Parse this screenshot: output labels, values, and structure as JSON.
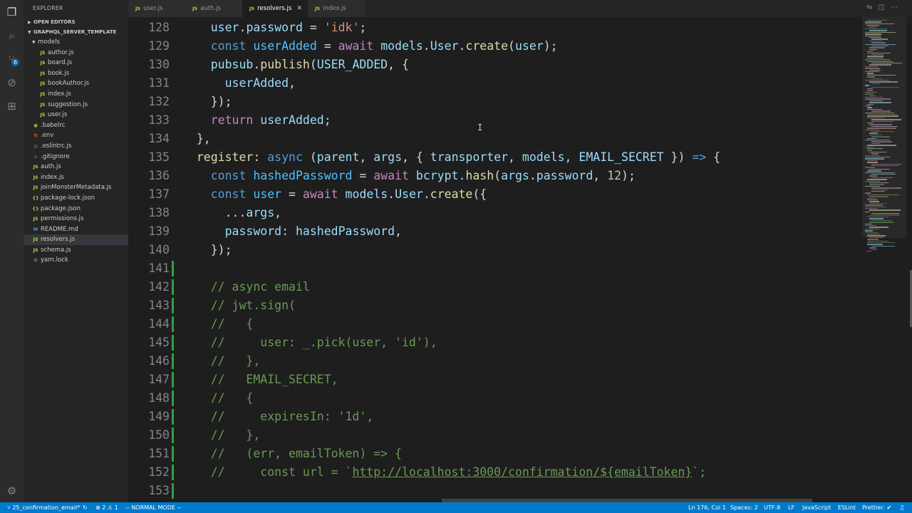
{
  "sidebar": {
    "title": "EXPLORER",
    "open_editors": "OPEN EDITORS",
    "project": "GRAPHQL_SERVER_TEMPLATE",
    "tree": [
      {
        "label": "models",
        "type": "folder",
        "depth": 1
      },
      {
        "label": "author.js",
        "type": "js",
        "depth": 2
      },
      {
        "label": "board.js",
        "type": "js",
        "depth": 2
      },
      {
        "label": "book.js",
        "type": "js",
        "depth": 2
      },
      {
        "label": "bookAuthor.js",
        "type": "js",
        "depth": 2
      },
      {
        "label": "index.js",
        "type": "js",
        "depth": 2
      },
      {
        "label": "suggestion.js",
        "type": "js",
        "depth": 2
      },
      {
        "label": "user.js",
        "type": "js",
        "depth": 2
      },
      {
        "label": ".babelrc",
        "type": "babel",
        "depth": 1
      },
      {
        "label": ".env",
        "type": "env",
        "depth": 1
      },
      {
        "label": ".eslintrc.js",
        "type": "eslint",
        "depth": 1
      },
      {
        "label": ".gitignore",
        "type": "git",
        "depth": 1
      },
      {
        "label": "auth.js",
        "type": "js",
        "depth": 1
      },
      {
        "label": "index.js",
        "type": "js",
        "depth": 1
      },
      {
        "label": "joinMonsterMetadata.js",
        "type": "js",
        "depth": 1
      },
      {
        "label": "package-lock.json",
        "type": "json",
        "depth": 1
      },
      {
        "label": "package.json",
        "type": "json",
        "depth": 1
      },
      {
        "label": "permissions.js",
        "type": "js",
        "depth": 1
      },
      {
        "label": "README.md",
        "type": "md",
        "depth": 1
      },
      {
        "label": "resolvers.js",
        "type": "js",
        "depth": 1,
        "selected": true
      },
      {
        "label": "schema.js",
        "type": "js",
        "depth": 1
      },
      {
        "label": "yarn.lock",
        "type": "yarn",
        "depth": 1
      }
    ]
  },
  "activity_badge": "6",
  "tabs": [
    {
      "label": "user.js",
      "active": false
    },
    {
      "label": "auth.js",
      "active": false
    },
    {
      "label": "resolvers.js",
      "active": true
    },
    {
      "label": "index.js",
      "active": false
    }
  ],
  "editor": {
    "lines": [
      {
        "n": "128",
        "mark": false,
        "tokens": [
          [
            "t",
            "    "
          ],
          [
            "v",
            "user"
          ],
          [
            "t",
            "."
          ],
          [
            "v",
            "password"
          ],
          [
            "t",
            " = "
          ],
          [
            "s",
            "'idk'"
          ],
          [
            "t",
            ";"
          ]
        ]
      },
      {
        "n": "129",
        "mark": false,
        "tokens": [
          [
            "t",
            "    "
          ],
          [
            "st",
            "const"
          ],
          [
            "t",
            " "
          ],
          [
            "cst",
            "userAdded"
          ],
          [
            "t",
            " = "
          ],
          [
            "k",
            "await"
          ],
          [
            "t",
            " "
          ],
          [
            "v",
            "models"
          ],
          [
            "t",
            "."
          ],
          [
            "v",
            "User"
          ],
          [
            "t",
            "."
          ],
          [
            "f",
            "create"
          ],
          [
            "t",
            "("
          ],
          [
            "v",
            "user"
          ],
          [
            "t",
            ");"
          ]
        ]
      },
      {
        "n": "130",
        "mark": false,
        "tokens": [
          [
            "t",
            "    "
          ],
          [
            "v",
            "pubsub"
          ],
          [
            "t",
            "."
          ],
          [
            "f",
            "publish"
          ],
          [
            "t",
            "("
          ],
          [
            "v",
            "USER_ADDED"
          ],
          [
            "t",
            ", {"
          ]
        ]
      },
      {
        "n": "131",
        "mark": false,
        "tokens": [
          [
            "t",
            "      "
          ],
          [
            "v",
            "userAdded"
          ],
          [
            "t",
            ","
          ]
        ]
      },
      {
        "n": "132",
        "mark": false,
        "tokens": [
          [
            "t",
            "    });"
          ]
        ]
      },
      {
        "n": "133",
        "mark": false,
        "tokens": [
          [
            "t",
            "    "
          ],
          [
            "k",
            "return"
          ],
          [
            "t",
            " "
          ],
          [
            "v",
            "userAdded"
          ],
          [
            "t",
            ";"
          ]
        ]
      },
      {
        "n": "134",
        "mark": false,
        "tokens": [
          [
            "t",
            "  },"
          ]
        ]
      },
      {
        "n": "135",
        "mark": false,
        "tokens": [
          [
            "t",
            "  "
          ],
          [
            "f",
            "register"
          ],
          [
            "t",
            ": "
          ],
          [
            "st",
            "async"
          ],
          [
            "t",
            " ("
          ],
          [
            "v",
            "parent"
          ],
          [
            "t",
            ", "
          ],
          [
            "v",
            "args"
          ],
          [
            "t",
            ", { "
          ],
          [
            "v",
            "transporter"
          ],
          [
            "t",
            ", "
          ],
          [
            "v",
            "models"
          ],
          [
            "t",
            ", "
          ],
          [
            "v",
            "EMAIL_SECRET"
          ],
          [
            "t",
            " }) "
          ],
          [
            "st",
            "=>"
          ],
          [
            "t",
            " {"
          ]
        ]
      },
      {
        "n": "136",
        "mark": false,
        "tokens": [
          [
            "t",
            "    "
          ],
          [
            "st",
            "const"
          ],
          [
            "t",
            " "
          ],
          [
            "cst",
            "hashedPassword"
          ],
          [
            "t",
            " = "
          ],
          [
            "k",
            "await"
          ],
          [
            "t",
            " "
          ],
          [
            "v",
            "bcrypt"
          ],
          [
            "t",
            "."
          ],
          [
            "f",
            "hash"
          ],
          [
            "t",
            "("
          ],
          [
            "v",
            "args"
          ],
          [
            "t",
            "."
          ],
          [
            "v",
            "password"
          ],
          [
            "t",
            ", "
          ],
          [
            "n",
            "12"
          ],
          [
            "t",
            ");"
          ]
        ]
      },
      {
        "n": "137",
        "mark": false,
        "tokens": [
          [
            "t",
            "    "
          ],
          [
            "st",
            "const"
          ],
          [
            "t",
            " "
          ],
          [
            "cst",
            "user"
          ],
          [
            "t",
            " = "
          ],
          [
            "k",
            "await"
          ],
          [
            "t",
            " "
          ],
          [
            "v",
            "models"
          ],
          [
            "t",
            "."
          ],
          [
            "v",
            "User"
          ],
          [
            "t",
            "."
          ],
          [
            "f",
            "create"
          ],
          [
            "t",
            "({"
          ]
        ]
      },
      {
        "n": "138",
        "mark": false,
        "tokens": [
          [
            "t",
            "      ..."
          ],
          [
            "v",
            "args"
          ],
          [
            "t",
            ","
          ]
        ]
      },
      {
        "n": "139",
        "mark": false,
        "tokens": [
          [
            "t",
            "      "
          ],
          [
            "v",
            "password"
          ],
          [
            "t",
            ": "
          ],
          [
            "v",
            "hashedPassword"
          ],
          [
            "t",
            ","
          ]
        ]
      },
      {
        "n": "140",
        "mark": false,
        "tokens": [
          [
            "t",
            "    });"
          ]
        ]
      },
      {
        "n": "141",
        "mark": true,
        "tokens": []
      },
      {
        "n": "142",
        "mark": true,
        "tokens": [
          [
            "t",
            "    "
          ],
          [
            "c",
            "// async email"
          ]
        ]
      },
      {
        "n": "143",
        "mark": true,
        "tokens": [
          [
            "t",
            "    "
          ],
          [
            "c",
            "// jwt.sign("
          ]
        ]
      },
      {
        "n": "144",
        "mark": true,
        "tokens": [
          [
            "t",
            "    "
          ],
          [
            "c",
            "//   {"
          ]
        ]
      },
      {
        "n": "145",
        "mark": true,
        "tokens": [
          [
            "t",
            "    "
          ],
          [
            "c",
            "//     user: _.pick(user, 'id'),"
          ]
        ]
      },
      {
        "n": "146",
        "mark": true,
        "tokens": [
          [
            "t",
            "    "
          ],
          [
            "c",
            "//   },"
          ]
        ]
      },
      {
        "n": "147",
        "mark": true,
        "tokens": [
          [
            "t",
            "    "
          ],
          [
            "c",
            "//   EMAIL_SECRET,"
          ]
        ]
      },
      {
        "n": "148",
        "mark": true,
        "tokens": [
          [
            "t",
            "    "
          ],
          [
            "c",
            "//   {"
          ]
        ]
      },
      {
        "n": "149",
        "mark": true,
        "tokens": [
          [
            "t",
            "    "
          ],
          [
            "c",
            "//     expiresIn: '1d',"
          ]
        ]
      },
      {
        "n": "150",
        "mark": true,
        "tokens": [
          [
            "t",
            "    "
          ],
          [
            "c",
            "//   },"
          ]
        ]
      },
      {
        "n": "151",
        "mark": true,
        "tokens": [
          [
            "t",
            "    "
          ],
          [
            "c",
            "//   (err, emailToken) => {"
          ]
        ]
      },
      {
        "n": "152",
        "mark": true,
        "tokens": [
          [
            "t",
            "    "
          ],
          [
            "c",
            "//     const url = `"
          ],
          [
            "cu",
            "http://localhost:3000/confirmation/${emailToken}"
          ],
          [
            "c",
            "`;"
          ]
        ]
      },
      {
        "n": "153",
        "mark": true,
        "tokens": []
      }
    ]
  },
  "statusbar": {
    "branch": "25_confirmation_email*",
    "problems": "⊗ 2 ⚠ 1",
    "mode": "-- NORMAL MODE --",
    "position": "Ln 176, Col 1",
    "spaces": "Spaces: 2",
    "encoding": "UTF-8",
    "eol": "LF",
    "language": "JavaScript",
    "linter": "ESLint",
    "formatter": "Prettier: ✔"
  },
  "colors": {
    "statusbar": "#007acc",
    "editor_bg": "#1e1e1e",
    "sidebar_bg": "#252526",
    "added_gutter": "#2ea043"
  }
}
